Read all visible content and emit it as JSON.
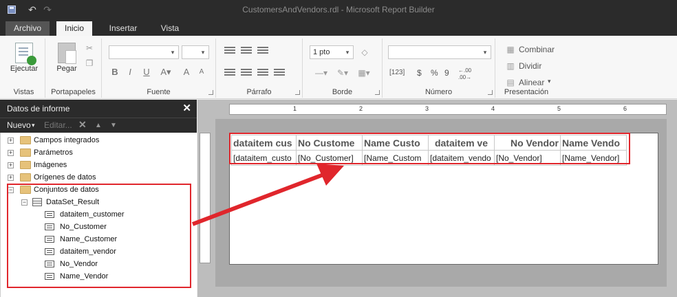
{
  "window": {
    "title": "CustomersAndVendors.rdl - Microsoft Report Builder"
  },
  "tabs": [
    {
      "label": "Archivo"
    },
    {
      "label": "Inicio"
    },
    {
      "label": "Insertar"
    },
    {
      "label": "Vista"
    }
  ],
  "ribbon": {
    "vistas": {
      "group_label": "Vistas",
      "run_label": "Ejecutar"
    },
    "portapapeles": {
      "group_label": "Portapapeles",
      "paste_label": "Pegar"
    },
    "fuente": {
      "group_label": "Fuente",
      "bold": "B",
      "italic": "I",
      "underline": "U"
    },
    "parrafo": {
      "group_label": "Párrafo"
    },
    "borde": {
      "group_label": "Borde",
      "width_value": "1 pto"
    },
    "numero": {
      "group_label": "Número",
      "placeholders": "[123]",
      "currency": "$",
      "percent": "%",
      "style": "9",
      "inc_dec": "←.00",
      "dec_dec": ".00→"
    },
    "presentacion": {
      "group_label": "Presentación",
      "merge": "Combinar",
      "split": "Dividir",
      "align": "Alinear"
    }
  },
  "report_data_panel": {
    "title": "Datos de informe",
    "close": "✕",
    "toolbar": {
      "new": "Nuevo",
      "edit": "Editar..."
    },
    "tree": {
      "built_in_fields": "Campos integrados",
      "parameters": "Parámetros",
      "images": "Imágenes",
      "data_sources": "Orígenes de datos",
      "datasets": "Conjuntos de datos",
      "dataset_name": "DataSet_Result",
      "fields": [
        "dataitem_customer",
        "No_Customer",
        "Name_Customer",
        "dataitem_vendor",
        "No_Vendor",
        "Name_Vendor"
      ]
    }
  },
  "ruler": {
    "marks": [
      "1",
      "2",
      "3",
      "4",
      "5",
      "6"
    ]
  },
  "report_table": {
    "headers": [
      "dataitem cus",
      "No Custome",
      "Name Custo",
      "dataitem ve",
      "No Vendor",
      "Name Vendo"
    ],
    "cells": [
      "[dataitem_custo",
      "[No_Customer]",
      "[Name_Custom",
      "[dataitem_vendo",
      "[No_Vendor]",
      "[Name_Vendor]"
    ]
  },
  "colors": {
    "annotation": "#e0262c",
    "chrome_dark": "#2b2b2b"
  }
}
